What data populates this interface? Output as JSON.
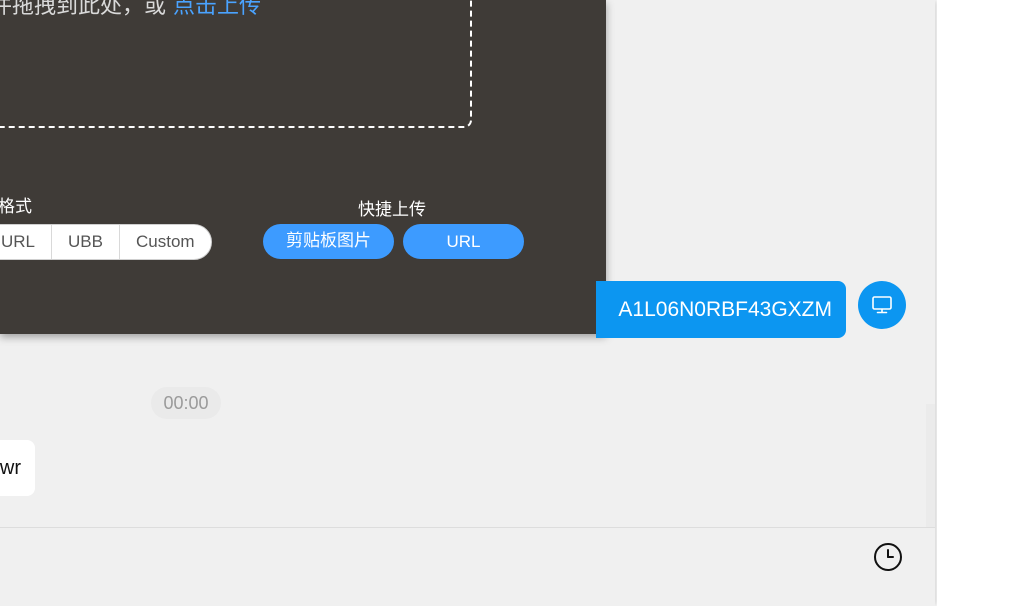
{
  "upload": {
    "drop_text": "件拖拽到此处，或 ",
    "drop_link": "点击上传",
    "format_label": "格式",
    "format_options": [
      "URL",
      "UBB",
      "Custom"
    ],
    "quick_label": "快捷上传",
    "clipboard_button": "剪贴板图片",
    "url_button": "URL"
  },
  "chat": {
    "id_label": "A1L06N0RBF43GXZM",
    "time": "00:00",
    "message_text": "wr"
  },
  "icons": {
    "device": "monitor-icon",
    "clock": "clock-icon"
  },
  "colors": {
    "panel_bg": "#3f3b37",
    "accent": "#0c96f1",
    "pill": "#3d9bff",
    "link": "#4aa3ff"
  }
}
